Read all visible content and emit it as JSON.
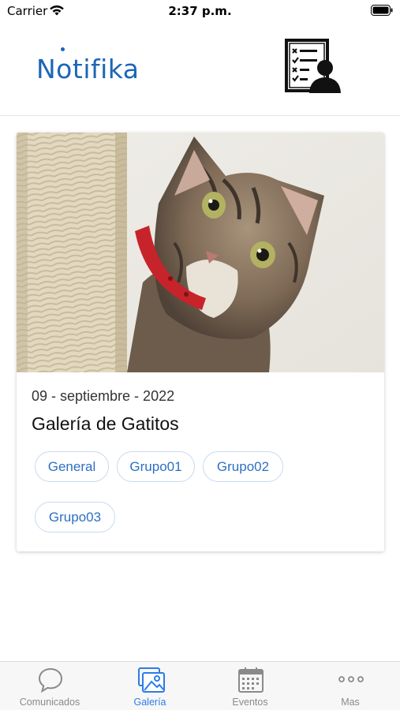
{
  "status_bar": {
    "carrier": "Carrier",
    "time": "2:37 p.m."
  },
  "header": {
    "logo_text": "Notifika",
    "profile_icon": "checklist-user-icon"
  },
  "card": {
    "date": "09 - septiembre - 2022",
    "title": "Galería de Gatitos",
    "image": "kitten-photo",
    "chips": [
      "General",
      "Grupo01",
      "Grupo02",
      "Grupo03"
    ]
  },
  "tabs": [
    {
      "label": "Comunicados",
      "icon": "chat-bubble-icon",
      "active": false
    },
    {
      "label": "Galería",
      "icon": "gallery-icon",
      "active": true
    },
    {
      "label": "Eventos",
      "icon": "calendar-icon",
      "active": false
    },
    {
      "label": "Mas",
      "icon": "more-dots-icon",
      "active": false
    }
  ],
  "colors": {
    "brand": "#1c66b8",
    "active_tab": "#2b7de9",
    "chip_text": "#2d6fc4",
    "chip_border": "#c9d9ee"
  }
}
